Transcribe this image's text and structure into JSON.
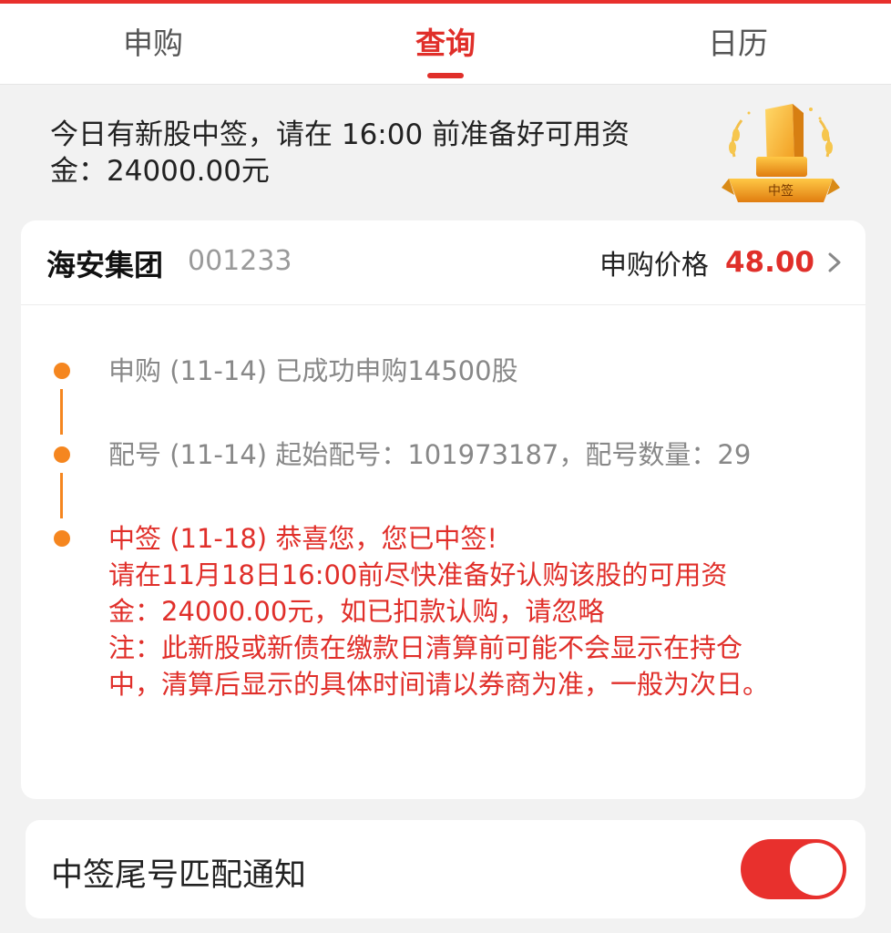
{
  "tabs": [
    {
      "label": "申购"
    },
    {
      "label": "查询"
    },
    {
      "label": "日历"
    }
  ],
  "notice": {
    "line1": "今日有新股中签，请在 16:00 前准备好可用资",
    "line2": "金：24000.00元"
  },
  "trophy": {
    "badge": "中签"
  },
  "stock": {
    "name": "海安集团",
    "code": "001233",
    "price_label": "申购价格",
    "price_value": "48.00"
  },
  "timeline": {
    "step1": "申购 (11-14) 已成功申购14500股",
    "step2": "配号 (11-14) 起始配号：101973187，配号数量：29",
    "step3": [
      "中签 (11-18) 恭喜您，您已中签!",
      "请在11月18日16:00前尽快准备好认购该股的可用资",
      "金：24000.00元，如已扣款认购，请忽略",
      "注：此新股或新债在缴款日清算前可能不会显示在持仓",
      "中，清算后显示的具体时间请以券商为准，一般为次日。"
    ]
  },
  "notify": {
    "label": "中签尾号匹配通知",
    "enabled": true
  },
  "colors": {
    "accent": "#e02f2a",
    "timeline": "#f5861f",
    "background": "#f2f2f2"
  }
}
